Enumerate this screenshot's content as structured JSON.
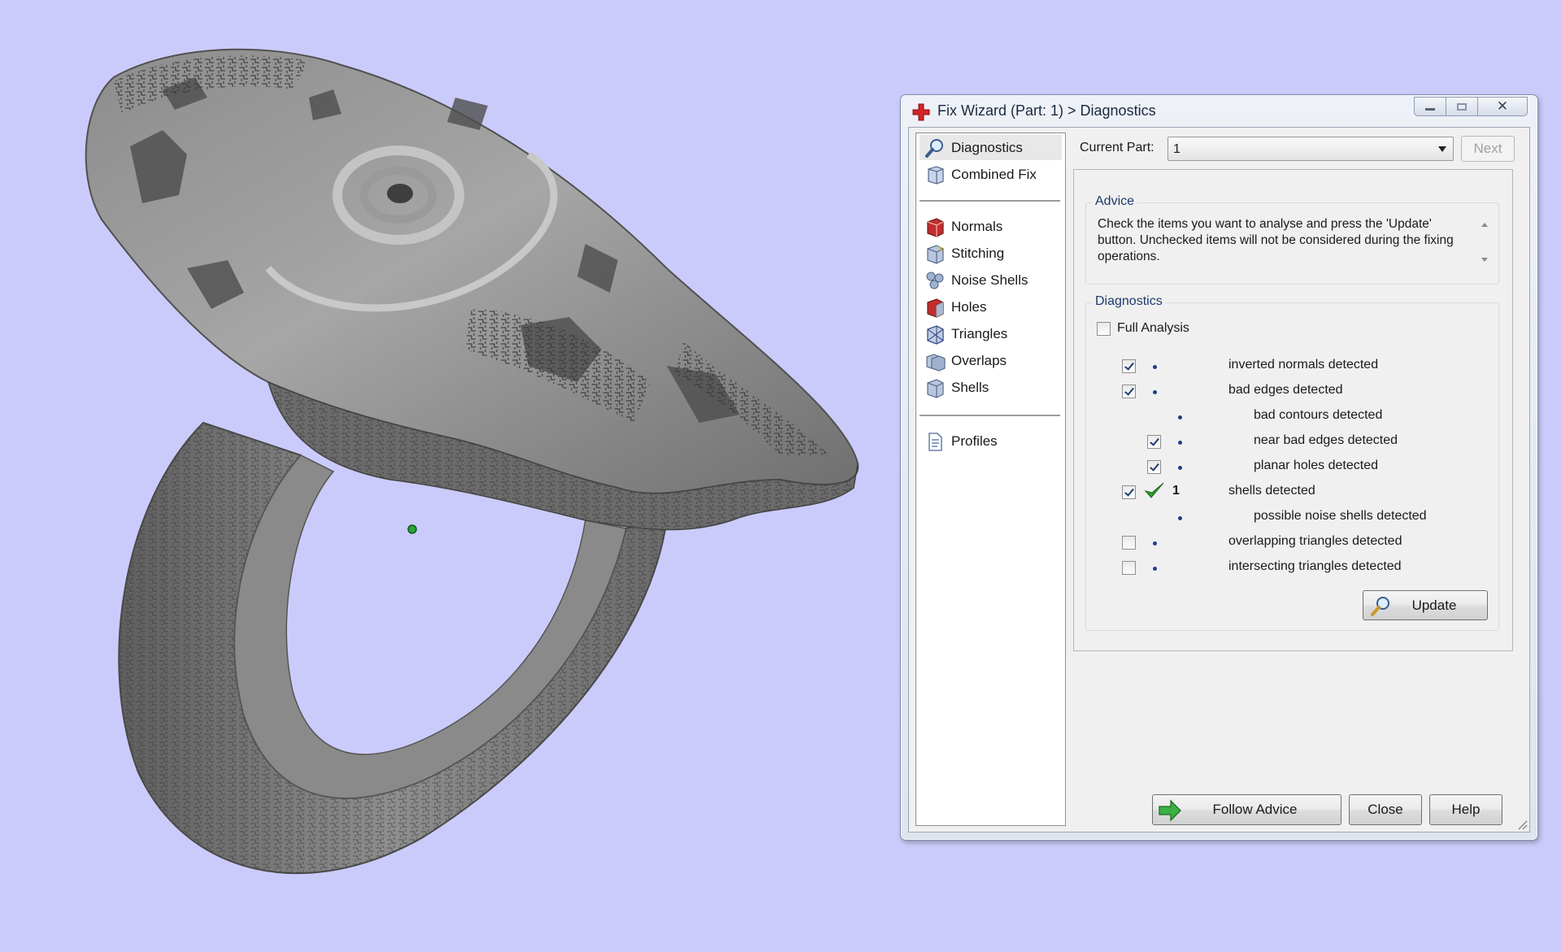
{
  "window": {
    "title": "Fix Wizard (Part: 1) > Diagnostics",
    "minimize_icon": "minimize-icon",
    "maximize_icon": "maximize-icon",
    "close_icon": "close-icon"
  },
  "nav": {
    "top_items": [
      {
        "label": "Diagnostics",
        "icon": "magnifier-icon",
        "selected": true
      },
      {
        "label": "Combined Fix",
        "icon": "cube-stack-icon"
      }
    ],
    "fix_items": [
      {
        "label": "Normals",
        "icon": "normals-cube-icon"
      },
      {
        "label": "Stitching",
        "icon": "stitching-cube-icon"
      },
      {
        "label": "Noise Shells",
        "icon": "noise-shells-icon"
      },
      {
        "label": "Holes",
        "icon": "holes-cube-icon"
      },
      {
        "label": "Triangles",
        "icon": "triangles-icon"
      },
      {
        "label": "Overlaps",
        "icon": "overlaps-icon"
      },
      {
        "label": "Shells",
        "icon": "shells-icon"
      }
    ],
    "bottom_items": [
      {
        "label": "Profiles",
        "icon": "document-icon"
      }
    ]
  },
  "header": {
    "current_part_label": "Current Part:",
    "current_part_value": "1",
    "next_label": "Next"
  },
  "advice": {
    "title": "Advice",
    "text": "Check the items you want to analyse and press the 'Update' button. Unchecked items will not be considered during the fixing operations."
  },
  "diagnostics": {
    "title": "Diagnostics",
    "full_analysis_label": "Full Analysis",
    "full_analysis_checked": false,
    "rows": [
      {
        "label": "inverted normals detected",
        "checked": true,
        "level": 0
      },
      {
        "label": "bad edges detected",
        "checked": true,
        "level": 0
      },
      {
        "label": "bad contours detected",
        "checked": null,
        "level": 1
      },
      {
        "label": "near bad edges detected",
        "checked": true,
        "level": 1
      },
      {
        "label": "planar holes detected",
        "checked": true,
        "level": 1
      },
      {
        "label": "shells detected",
        "checked": true,
        "level": 0,
        "status": "ok",
        "count": "1"
      },
      {
        "label": "possible noise shells detected",
        "checked": null,
        "level": 1
      },
      {
        "label": "overlapping triangles detected",
        "checked": false,
        "level": 0
      },
      {
        "label": "intersecting triangles detected",
        "checked": false,
        "level": 0
      }
    ],
    "update_label": "Update"
  },
  "footer": {
    "follow_advice_label": "Follow Advice",
    "close_label": "Close",
    "help_label": "Help"
  },
  "colors": {
    "background": "#cbcbfb",
    "model_gray": "#8e8e8e",
    "accent_blue": "#1e3f8a",
    "ok_green": "#2e9a2e"
  }
}
